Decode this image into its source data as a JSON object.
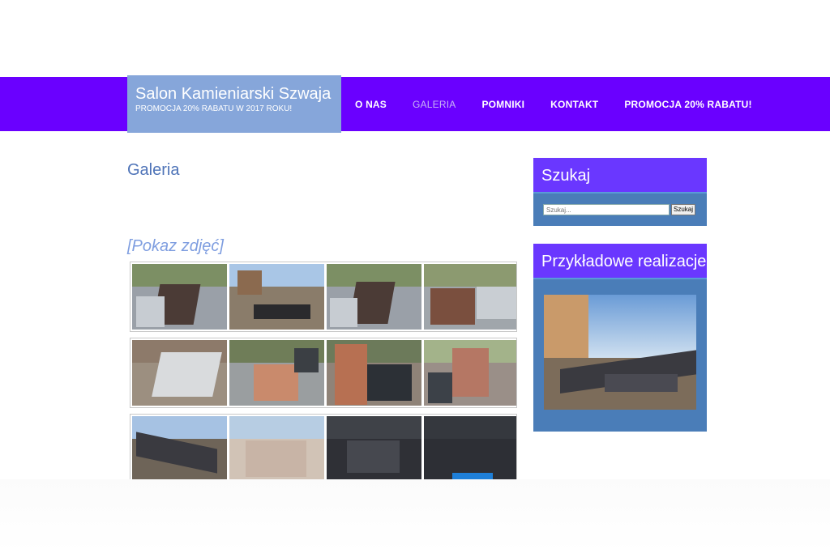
{
  "header": {
    "site_title": "Salon Kamieniarski Szwaja",
    "tagline": "PROMOCJA 20% RABATU W 2017 ROKU!"
  },
  "nav": {
    "items": [
      {
        "label": "O NAS"
      },
      {
        "label": "GALERIA"
      },
      {
        "label": "POMNIKI"
      },
      {
        "label": "KONTAKT"
      },
      {
        "label": "PROMOCJA 20% RABATU!"
      }
    ]
  },
  "main": {
    "title": "Galeria",
    "slideshow_link": "[Pokaz zdjęć]"
  },
  "sidebar": {
    "search": {
      "heading": "Szukaj",
      "placeholder": "Szukaj...",
      "button": "Szukaj"
    },
    "featured": {
      "heading": "Przykładowe realizacje"
    }
  },
  "colors": {
    "nav_bar": "#6a00ff",
    "brand_box": "#86a6da",
    "widget_head": "#6a37ff",
    "widget_body": "#4a7db8",
    "link": "#4f74b8"
  }
}
